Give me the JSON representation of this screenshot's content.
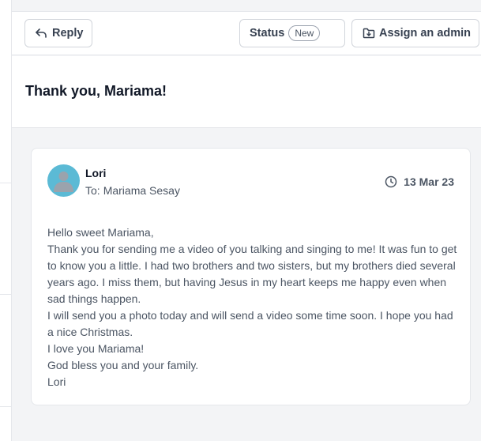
{
  "toolbar": {
    "reply_label": "Reply",
    "status_label": "Status",
    "status_value": "New",
    "assign_label": "Assign an admin"
  },
  "conversation": {
    "title": "Thank you, Mariama!"
  },
  "message": {
    "sender": "Lori",
    "to_label": "To:",
    "recipient": "Mariama Sesay",
    "date": "13 Mar 23",
    "lines": [
      "Hello sweet Mariama,",
      "Thank you for sending me a video of you talking and singing to me! It was fun to get to know you a little. I had two brothers and two sisters, but my brothers died several years ago. I miss them, but having Jesus in my heart keeps me happy even when sad things happen.",
      "I will send you a photo today and will send a video some time soon. I hope you had a nice Christmas.",
      "I love you Mariama!",
      "God bless you and your family.",
      "Lori"
    ]
  },
  "icons": {
    "reply": "reply-arrow-icon",
    "assign": "download-folder-icon",
    "date": "clock-icon",
    "avatar": "user-silhouette-icon"
  },
  "colors": {
    "avatar_bg": "#5bbad5",
    "page_bg": "#f3f4f6",
    "text_muted": "#4b5563"
  }
}
